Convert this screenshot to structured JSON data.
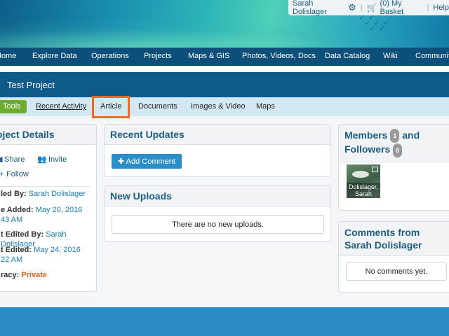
{
  "header": {
    "user_name": "Sarah Dolislager",
    "basket": "(0) My Basket",
    "help": "Help"
  },
  "nav": [
    "Home",
    "Explore Data",
    "Operations",
    "Projects",
    "Maps & GIS",
    "Photos, Videos, Docs",
    "Data Catalog",
    "Wiki",
    "Communit"
  ],
  "project": {
    "title": "Test Project"
  },
  "tabs": {
    "tools": "Tools",
    "recent_activity": "Recent Activity",
    "article": "Article",
    "documents": "Documents",
    "images_video": "Images & Video",
    "maps": "Maps"
  },
  "details": {
    "title": "oject Details",
    "share": "Share",
    "invite": "Invite",
    "follow": "Follow",
    "created_by_label": "led By:",
    "created_by": "Sarah Dolislager",
    "date_added_label": "e Added:",
    "date_added": "May 20, 2016",
    "time_added": "43 AM",
    "last_edited_by_label": "t Edited By:",
    "last_edited_by": "Sarah Dolislager",
    "last_edited_label": "t Edited:",
    "last_edited": "May 24, 2016",
    "time_edited": "22 AM",
    "privacy_label": "racy:",
    "privacy": "Private"
  },
  "recent_updates": {
    "title": "Recent Updates",
    "add_comment": "Add Comment"
  },
  "new_uploads": {
    "title": "New Uploads",
    "empty": "There are no new uploads."
  },
  "members": {
    "title_a": "Members",
    "title_b": "and",
    "title_c": "Followers",
    "members_count": "1",
    "followers_count": "0",
    "avatar_label_1": "Dolislager,",
    "avatar_label_2": "Sarah"
  },
  "comments": {
    "title": "Comments from Sarah Dolislager",
    "empty": "No comments yet."
  },
  "colors": {
    "nav": "#0c4f7a",
    "highlight": "#f26a21",
    "tools": "#6cad2d",
    "accent": "#1a5d86"
  }
}
